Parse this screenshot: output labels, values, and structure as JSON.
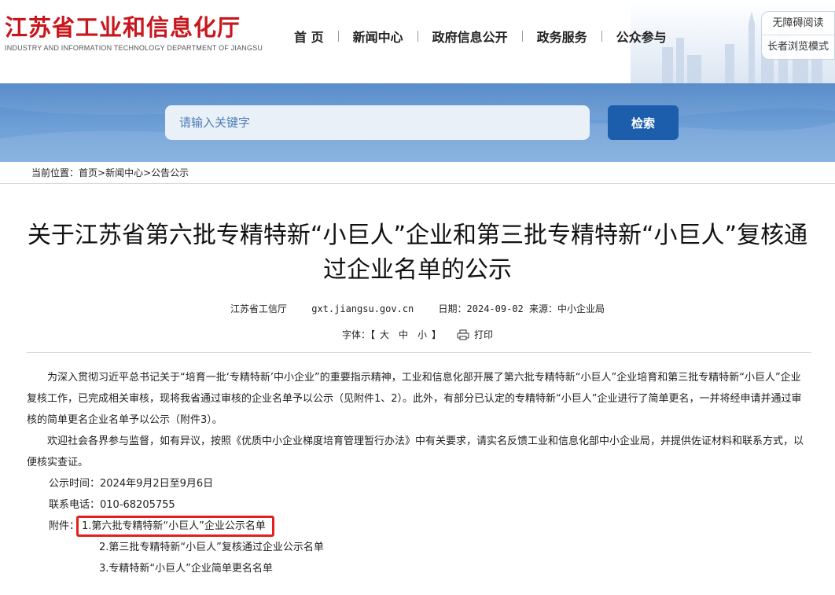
{
  "header": {
    "logo_cn": "江苏省工业和信息化厅",
    "logo_en": "INDUSTRY AND INFORMATION TECHNOLOGY DEPARTMENT OF JIANGSU",
    "nav": [
      "首 页",
      "新闻中心",
      "政府信息公开",
      "政务服务",
      "公众参与"
    ],
    "accessibility": [
      "无障碍阅读",
      "长者浏览模式"
    ]
  },
  "search": {
    "placeholder": "请输入关键字",
    "button": "检索"
  },
  "breadcrumb": {
    "prefix": "当前位置：",
    "items": [
      "首页",
      "新闻中心",
      "公告公示"
    ],
    "sep": ">"
  },
  "article": {
    "title": "关于江苏省第六批专精特新“小巨人”企业和第三批专精特新“小巨人”复核通过企业名单的公示",
    "source": "江苏省工信厅",
    "site": "gxt.jiangsu.gov.cn",
    "date": "日期：2024-09-02 来源：中小企业局",
    "font_label": "字体：【",
    "font_sizes": [
      "大",
      "中",
      "小"
    ],
    "font_close": "】",
    "print_label": "打印",
    "paragraphs": [
      "为深入贯彻习近平总书记关于“培育一批‘专精特新’中小企业”的重要指示精神，工业和信息化部开展了第六批专精特新“小巨人”企业培育和第三批专精特新“小巨人”企业复核工作，已完成相关审核，现将我省通过审核的企业名单予以公示（见附件1、2）。此外，有部分已认定的专精特新“小巨人”企业进行了简单更名，一并将经申请并通过审核的简单更名企业名单予以公示（附件3）。",
      "欢迎社会各界参与监督，如有异议，按照《优质中小企业梯度培育管理暂行办法》中有关要求，请实名反馈工业和信息化部中小企业局，并提供佐证材料和联系方式，以便核实查证。"
    ],
    "period": "公示时间：2024年9月2日至9月6日",
    "phone": "联系电话：010-68205755",
    "attach_label": "附件：",
    "attachments": [
      "1.第六批专精特新“小巨人”企业公示名单",
      "2.第三批专精特新“小巨人”复核通过企业公示名单",
      "3.专精特新“小巨人”企业简单更名名单"
    ]
  },
  "colors": {
    "brand_red": "#c8161d",
    "band_blue": "#5b8fcc",
    "button_blue": "#1c5eab",
    "highlight": "#e3211c"
  }
}
